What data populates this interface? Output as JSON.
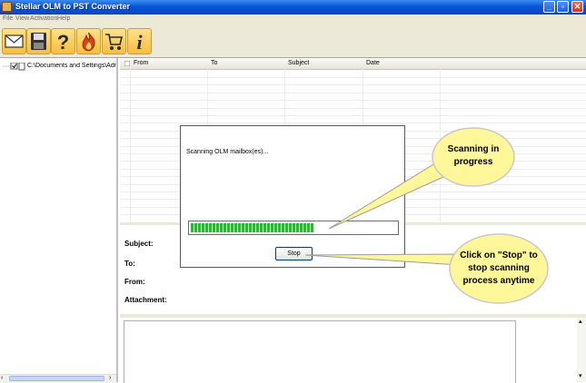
{
  "window": {
    "title": "Stellar OLM to PST Converter"
  },
  "menu": [
    "File",
    "View",
    "Activation",
    "Help"
  ],
  "toolbar": [
    "envelope-icon",
    "save-icon",
    "help-icon",
    "flame-icon",
    "cart-icon",
    "info-icon"
  ],
  "tree": {
    "root_label": "C:\\Documents and Settings\\Administrat"
  },
  "list": {
    "columns": [
      "From",
      "To",
      "Subject",
      "Date"
    ]
  },
  "preview": {
    "subject_label": "Subject:",
    "to_label": "To:",
    "from_label": "From:",
    "attachment_label": "Attachment:"
  },
  "dialog": {
    "message": "Scanning OLM mailbox(es)...",
    "progress": 0.6,
    "stop_label": "Stop"
  },
  "callouts": {
    "scanning": [
      "Scanning in",
      "progress"
    ],
    "stop": [
      "Click on \"Stop\" to",
      "stop scanning",
      "process anytime"
    ]
  },
  "colors": {
    "titlebar": "#0a55d8",
    "progress": "#2fb52f",
    "callout": "#fff79a",
    "toolbar_button": "#f7be3c"
  }
}
